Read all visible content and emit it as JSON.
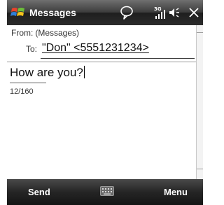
{
  "titlebar": {
    "app_title": "Messages",
    "icons": [
      "windows-start-icon",
      "notification-bubble-icon",
      "signal-3g-icon",
      "speaker-icon",
      "close-icon"
    ],
    "signal_badge": "3G"
  },
  "compose": {
    "from_label": "From:",
    "from_value": "(Messages)",
    "to_label": "To:",
    "to_value": "\"Don\" <5551231234>",
    "message_text": "How are you?",
    "char_count": "12/160"
  },
  "softkeys": {
    "left_label": "Send",
    "right_label": "Menu",
    "center_icon": "keyboard-icon"
  },
  "colors": {
    "titlebar": "#2c2c2c",
    "bottombar": "#1f1f1f",
    "text": "#111111"
  }
}
